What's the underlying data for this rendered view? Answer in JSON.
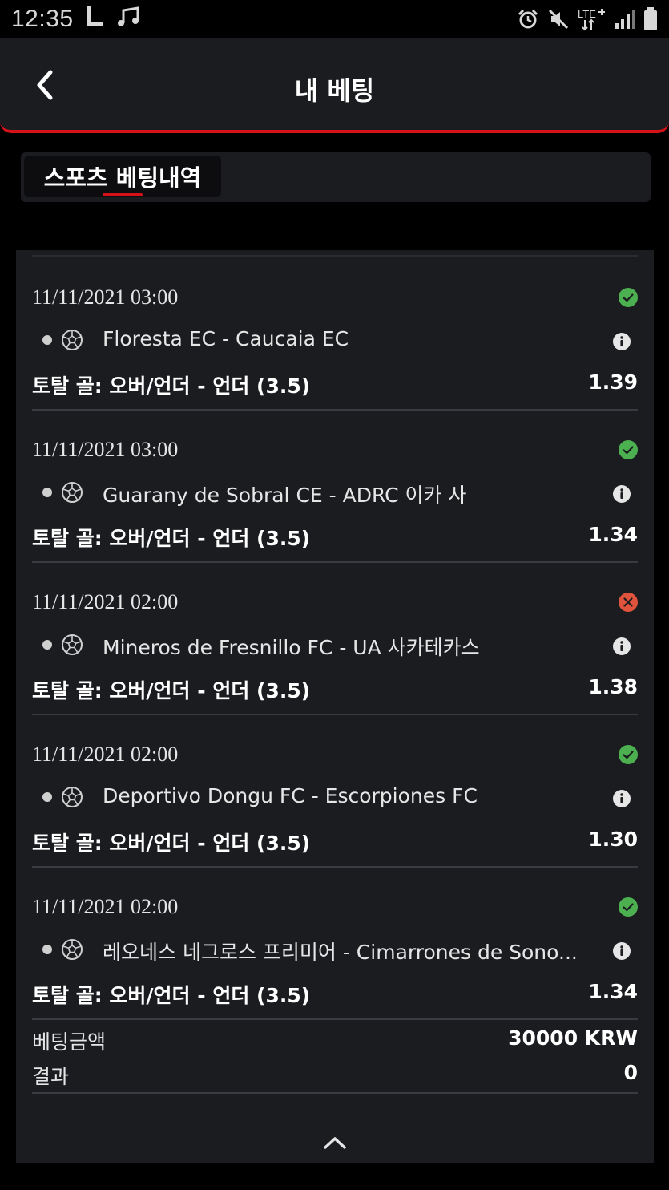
{
  "status_bar": {
    "time": "12:35",
    "network": "LTE"
  },
  "header": {
    "title": "내 베팅"
  },
  "tabs": [
    {
      "label": "스포츠 베팅내역",
      "active": true
    }
  ],
  "bets": [
    {
      "datetime": "11/11/2021 03:00",
      "status": "won",
      "match": "Floresta EC - Caucaia EC",
      "market": "토탈 골: 오버/언더 - 언더 (3.5)",
      "odds": "1.39"
    },
    {
      "datetime": "11/11/2021 03:00",
      "status": "won",
      "match": "Guarany de Sobral CE - ADRC 이카 사",
      "market": "토탈 골: 오버/언더 - 언더 (3.5)",
      "odds": "1.34"
    },
    {
      "datetime": "11/11/2021 02:00",
      "status": "lost",
      "match": "Mineros de Fresnillo FC - UA 사카테카스",
      "market": "토탈 골: 오버/언더 - 언더 (3.5)",
      "odds": "1.38"
    },
    {
      "datetime": "11/11/2021 02:00",
      "status": "won",
      "match": "Deportivo Dongu FC - Escorpiones FC",
      "market": "토탈 골: 오버/언더 - 언더 (3.5)",
      "odds": "1.30"
    },
    {
      "datetime": "11/11/2021 02:00",
      "status": "won",
      "match": "레오네스 네그로스 프리미어 - Cimarrones de Sono...",
      "market": "토탈 골: 오버/언더 - 언더 (3.5)",
      "odds": "1.34"
    }
  ],
  "summary": {
    "stake_label": "베팅금액",
    "stake_value": "30000 KRW",
    "result_label": "결과",
    "result_value": "0"
  },
  "colors": {
    "accent": "#d5121a",
    "won": "#4caf50",
    "lost": "#e0533d",
    "panel": "#1b1c20",
    "background": "#000000"
  },
  "icons": {
    "back": "chevron-left-icon",
    "won": "check-circle-icon",
    "lost": "x-circle-icon",
    "sport": "soccer-ball-icon",
    "info": "info-circle-icon",
    "collapse": "chevron-up-icon"
  }
}
